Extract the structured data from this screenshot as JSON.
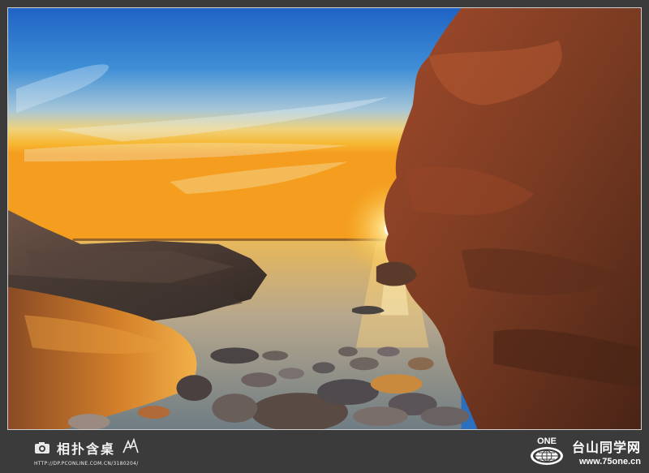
{
  "photo": {
    "description_icon": "sunset-coast-photo"
  },
  "watermark_left": {
    "brand": "相扑含桌",
    "url": "HTTP://DP.PCONLINE.COM.CN/3180204/",
    "icon": "camera-icon"
  },
  "watermark_right": {
    "logo_text": "ONE",
    "name": "台山同学网",
    "url": "www.75one.cn",
    "icon": "globe-icon"
  },
  "colors": {
    "sky_top": "#2a6fc0",
    "sky_horizon": "#f7b731",
    "sun": "#fff3b0",
    "rock": "#7a3b22",
    "sea": "#c9b89a",
    "footer_bg": "#3b3b3b"
  }
}
